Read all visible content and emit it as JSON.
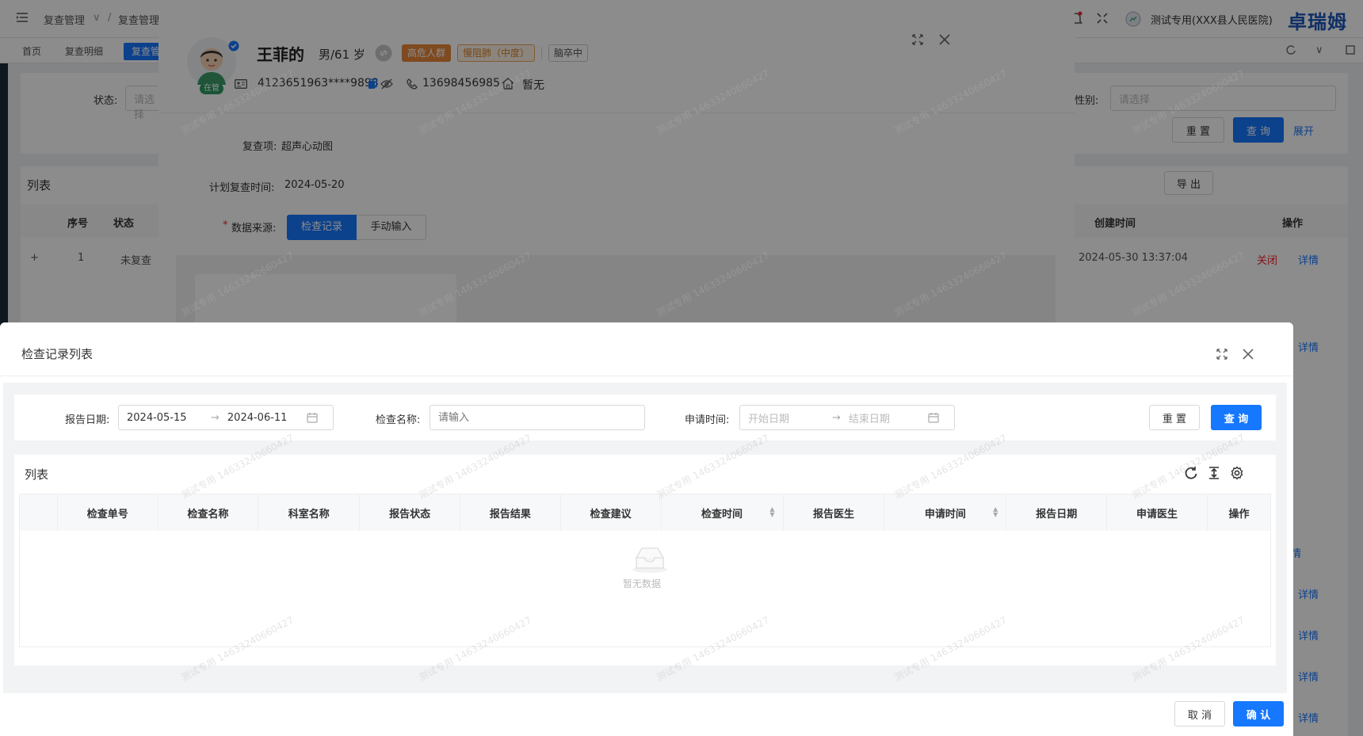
{
  "app": {
    "breadcrumb": [
      "复查管理",
      "复查管理"
    ],
    "hospital": "测试专用(XXX县人民医院)",
    "brand": "卓瑞姆",
    "tabs": [
      "首页",
      "复查明细",
      "复查管"
    ]
  },
  "background": {
    "status_label": "状态:",
    "status_placeholder": "请选择",
    "gender_label": "性别:",
    "gender_placeholder": "请选择",
    "reset": "重 置",
    "query": "查 询",
    "expand": "展开",
    "list_title": "列表",
    "export": "导 出",
    "columns": {
      "seq": "序号",
      "status": "状态",
      "created": "创建时间",
      "ops": "操作"
    },
    "row": {
      "plus": "+",
      "seq": "1",
      "status": "未复查",
      "created": "2024-05-30 13:37:04",
      "close": "关闭",
      "detail": "详情"
    },
    "detail_links": [
      "详情",
      "详情",
      "详情",
      "详情",
      "详情",
      "详情"
    ],
    "partial_link": "情"
  },
  "patient_modal": {
    "avatar_badge": "在管",
    "name": "王菲的",
    "gender_age": "男/61 岁",
    "tags": [
      {
        "text": "高危人群",
        "bg": "#e8883a",
        "color": "#ffffff",
        "border": "#e8883a"
      },
      {
        "text": "慢阻肺（中度）",
        "bg": "#fdf3e6",
        "color": "#d9822b",
        "border": "#e8a55c"
      },
      {
        "text": "脑卒中",
        "bg": "#ffffff",
        "color": "#555555",
        "border": "#cccccc"
      }
    ],
    "id_number": "4123651963****9898",
    "phone": "13698456985",
    "address": "暂无",
    "review_item_label": "复查项:",
    "review_item": "超声心动图",
    "plan_time_label": "计划复查时间:",
    "plan_time": "2024-05-20",
    "source_label": "数据来源:",
    "source_required": "*",
    "source_options": [
      "检查记录",
      "手动输入"
    ]
  },
  "exam_modal": {
    "title": "检查记录列表",
    "report_date_label": "报告日期:",
    "report_date_start": "2024-05-15",
    "report_date_end": "2024-06-11",
    "exam_name_label": "检查名称:",
    "exam_name_placeholder": "请输入",
    "apply_time_label": "申请时间:",
    "apply_time_start_placeholder": "开始日期",
    "apply_time_end_placeholder": "结束日期",
    "reset": "重 置",
    "query": "查 询",
    "list_title": "列表",
    "columns": [
      "检查单号",
      "检查名称",
      "科室名称",
      "报告状态",
      "报告结果",
      "检查建议",
      "检查时间",
      "报告医生",
      "申请时间",
      "报告日期",
      "申请医生",
      "操作"
    ],
    "empty_text": "暂无数据",
    "cancel": "取 消",
    "confirm": "确 认"
  },
  "watermark_text": "测试专用 14633240660427",
  "colors": {
    "primary": "#1677ff",
    "danger_tag": "#e8883a"
  }
}
